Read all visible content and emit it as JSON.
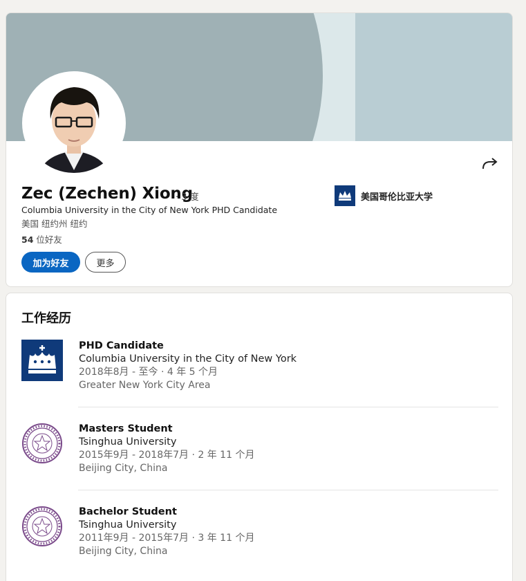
{
  "profile": {
    "name": "Zec (Zechen) Xiong",
    "degree": "· 3 度",
    "headline": "Columbia University in the City of New York PHD Candidate",
    "location": "美国 纽约州 纽约",
    "connections_count": "54",
    "connections_label": "位好友",
    "connect_button": "加为好友",
    "more_button": "更多",
    "school": "美国哥伦比亚大学",
    "share_icon": "share-arrow-icon"
  },
  "experience": {
    "title": "工作经历",
    "items": [
      {
        "title": "PHD Candidate",
        "org": "Columbia University in the City of New York",
        "dates": "2018年8月 - 至今 · 4 年 5 个月",
        "location": "Greater New York City Area",
        "logo": "columbia-crown-icon"
      },
      {
        "title": "Masters Student",
        "org": "Tsinghua University",
        "dates": "2015年9月 - 2018年7月 · 2 年 11 个月",
        "location": "Beijing City, China",
        "logo": "tsinghua-seal-icon"
      },
      {
        "title": "Bachelor Student",
        "org": "Tsinghua University",
        "dates": "2011年9月 - 2015年7月 · 3 年 11 个月",
        "location": "Beijing City, China",
        "logo": "tsinghua-seal-icon"
      }
    ]
  },
  "colors": {
    "accent": "#0a66c2",
    "columbia_blue": "#0f3a7a",
    "tsinghua_purple": "#7a4a8a",
    "cover": "#9fb1b5"
  }
}
